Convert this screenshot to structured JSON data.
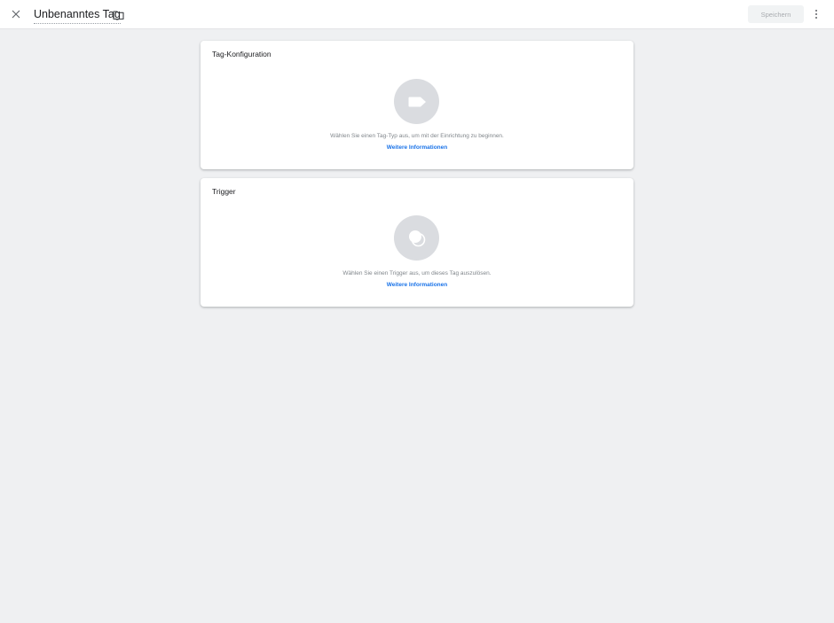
{
  "header": {
    "close_icon": "close-icon",
    "title": "Unbenanntes Tag",
    "folder_icon": "folder-icon",
    "save_label": "Speichern",
    "more_icon": "more-vert-icon"
  },
  "cards": {
    "tag_config": {
      "title": "Tag-Konfiguration",
      "icon": "tag-icon",
      "description": "Wählen Sie einen Tag-Typ aus, um mit der Einrichtung zu beginnen.",
      "link": "Weitere Informationen"
    },
    "trigger": {
      "title": "Trigger",
      "icon": "trigger-icon",
      "description": "Wählen Sie einen Trigger aus, um dieses Tag auszulösen.",
      "link": "Weitere Informationen"
    }
  },
  "colors": {
    "background": "#eff0f2",
    "card": "#ffffff",
    "icon_circle": "#dadce0",
    "link": "#1a73e8",
    "muted_text": "#80868b"
  }
}
